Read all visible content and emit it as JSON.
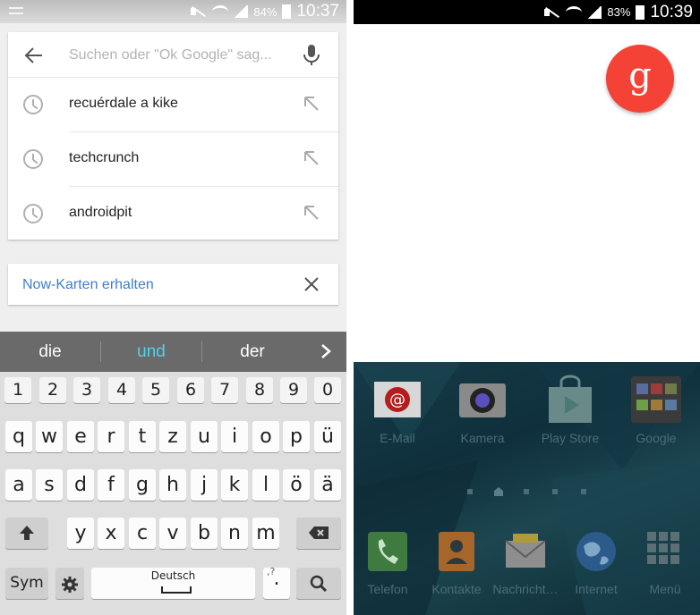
{
  "left_screen": {
    "status_bar": {
      "battery": "84%",
      "time": "10:37"
    },
    "search": {
      "placeholder": "Suchen oder \"Ok Google\" sag..."
    },
    "history": [
      "recuérdale a kike",
      "techcrunch",
      "androidpit"
    ],
    "now_card": {
      "label": "Now-Karten erhalten"
    },
    "keyboard": {
      "predictions": [
        "die",
        "und",
        "der"
      ],
      "highlight_color": "#52d0f0",
      "number_row": [
        "1",
        "2",
        "3",
        "4",
        "5",
        "6",
        "7",
        "8",
        "9",
        "0"
      ],
      "row1": [
        "q",
        "w",
        "e",
        "r",
        "t",
        "z",
        "u",
        "i",
        "o",
        "p",
        "ü"
      ],
      "row2": [
        "a",
        "s",
        "d",
        "f",
        "g",
        "h",
        "j",
        "k",
        "l",
        "ö",
        "ä"
      ],
      "row3": [
        "y",
        "x",
        "c",
        "v",
        "b",
        "n",
        "m"
      ],
      "sym_label": "Sym",
      "space_label": "Deutsch",
      "punct_label": ".",
      "punct_hint": ",?",
      "shift_icon": "shift-icon",
      "backspace_icon": "backspace-icon",
      "settings_icon": "gear-icon",
      "search_icon": "search-icon"
    }
  },
  "right_screen": {
    "status_bar": {
      "battery": "83%",
      "time": "10:39"
    },
    "google_button": {
      "glyph": "g",
      "color": "#f44336"
    },
    "apps_top": [
      "E-Mail",
      "Kamera",
      "Play Store",
      "Google"
    ],
    "dock": [
      "Telefon",
      "Kontakte",
      "Nachricht…",
      "Internet",
      "Menü"
    ],
    "page_indicator": {
      "pages": 5,
      "home_index": 1
    }
  }
}
